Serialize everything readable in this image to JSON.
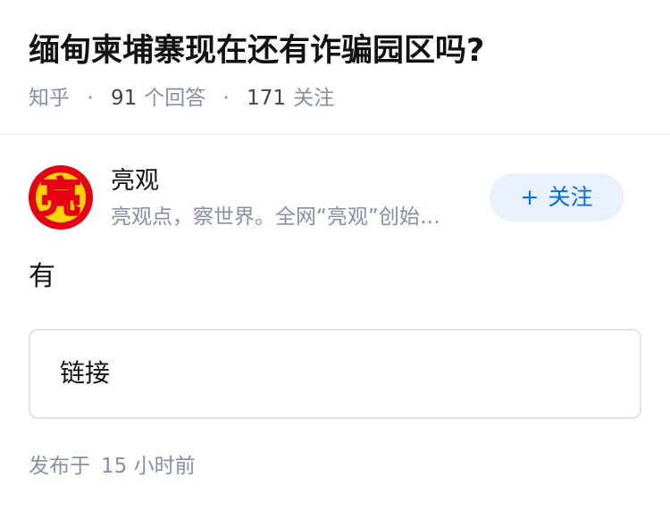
{
  "question": {
    "title": "缅甸柬埔寨现在还有诈骗园区吗?",
    "source": "知乎",
    "answer_count": "91",
    "answer_label": "个回答",
    "follower_count": "171",
    "follower_label": "关注",
    "separator": "·"
  },
  "author": {
    "avatar_char": "亮",
    "name": "亮观",
    "bio": "亮观点，察世界。全网“亮观”创始…",
    "follow_plus": "+",
    "follow_label": "关注"
  },
  "answer": {
    "text": "有",
    "link_label": "链接"
  },
  "publish": {
    "prefix": "发布于",
    "time": "15 小时前"
  },
  "colors": {
    "accent": "#056de8",
    "follow_bg": "#e8f1fb",
    "meta_gray": "#8590a6",
    "avatar_red": "#e60012",
    "avatar_yellow": "#ffd500"
  }
}
